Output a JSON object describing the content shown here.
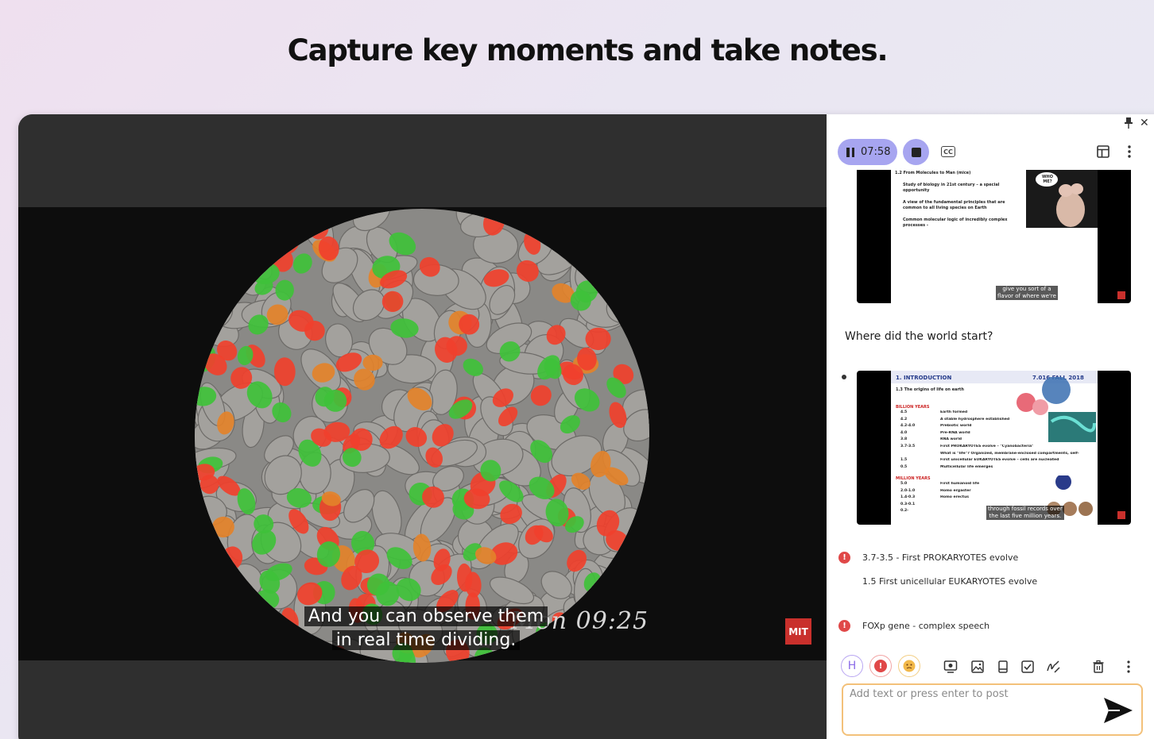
{
  "headline": "Capture key moments and take notes.",
  "video": {
    "subtitle_line1": "And you can observe them",
    "subtitle_line2": "in real time dividing.",
    "overlay_timestamp": "Mon 09:25",
    "badge": "MIT"
  },
  "panel": {
    "recording_time": "07:58",
    "cc_label": "CC",
    "slide1": {
      "title": "1.2 From Molecules to Man (mice)",
      "lines": [
        "Study of biology in 21st century – a special opportunity",
        "A view of the fundamental principles that are common to all living species on Earth",
        "Common molecular logic of incredibly complex processes -"
      ],
      "caption_line1": "give you sort of a",
      "caption_line2": "flavor of where we're",
      "speech_bubble": "WHO ME?"
    },
    "note_heading": "Where did the world start?",
    "slide2": {
      "header_left": "1. INTRODUCTION",
      "header_right": "7.016 FALL 2018",
      "subtitle": "1.3 The origins of life on earth",
      "section1": "BILLION YEARS",
      "rows1": [
        [
          "4.5",
          "Earth formed"
        ],
        [
          "4.2",
          "A stable hydrosphere established"
        ],
        [
          "4.2-4.0",
          "Prebiotic world"
        ],
        [
          "4.0",
          "Pre-RNA world"
        ],
        [
          "3.8",
          "RNA world"
        ],
        [
          "3.7-3.5",
          "First PROKARYOTES evolve – \"Cyanobacteria\""
        ],
        [
          "",
          "What is \"life\"? Organized, membrane-enclosed compartments, self-replicating"
        ],
        [
          "1.5",
          "First unicellular EUKARYOTES evolve – cells are nucleated"
        ],
        [
          "0.5",
          "Multicellular life emerges"
        ]
      ],
      "section2": "MILLION YEARS",
      "rows2": [
        [
          "5.0",
          "First humanoid life"
        ],
        [
          "2.0-1.0",
          "Homo ergaster"
        ],
        [
          "1.4-0.3",
          "Homo erectus"
        ],
        [
          "0.3-0.1",
          ""
        ],
        [
          "0.2-",
          ""
        ]
      ],
      "caption_line1": "through fossil records over",
      "caption_line2": "the last five million years."
    },
    "note1_line1": "3.7-3.5 - First PROKARYOTES evolve",
    "note1_line2": "1.5 First unicellular EUKARYOTES evolve",
    "note2": "FOXp gene - complex speech",
    "tag_h": "H",
    "post_placeholder": "Add text or press enter to post"
  },
  "colors": {
    "accent_purple": "#a7a5f0",
    "alert_red": "#e04848",
    "input_border": "#f3c17a"
  }
}
